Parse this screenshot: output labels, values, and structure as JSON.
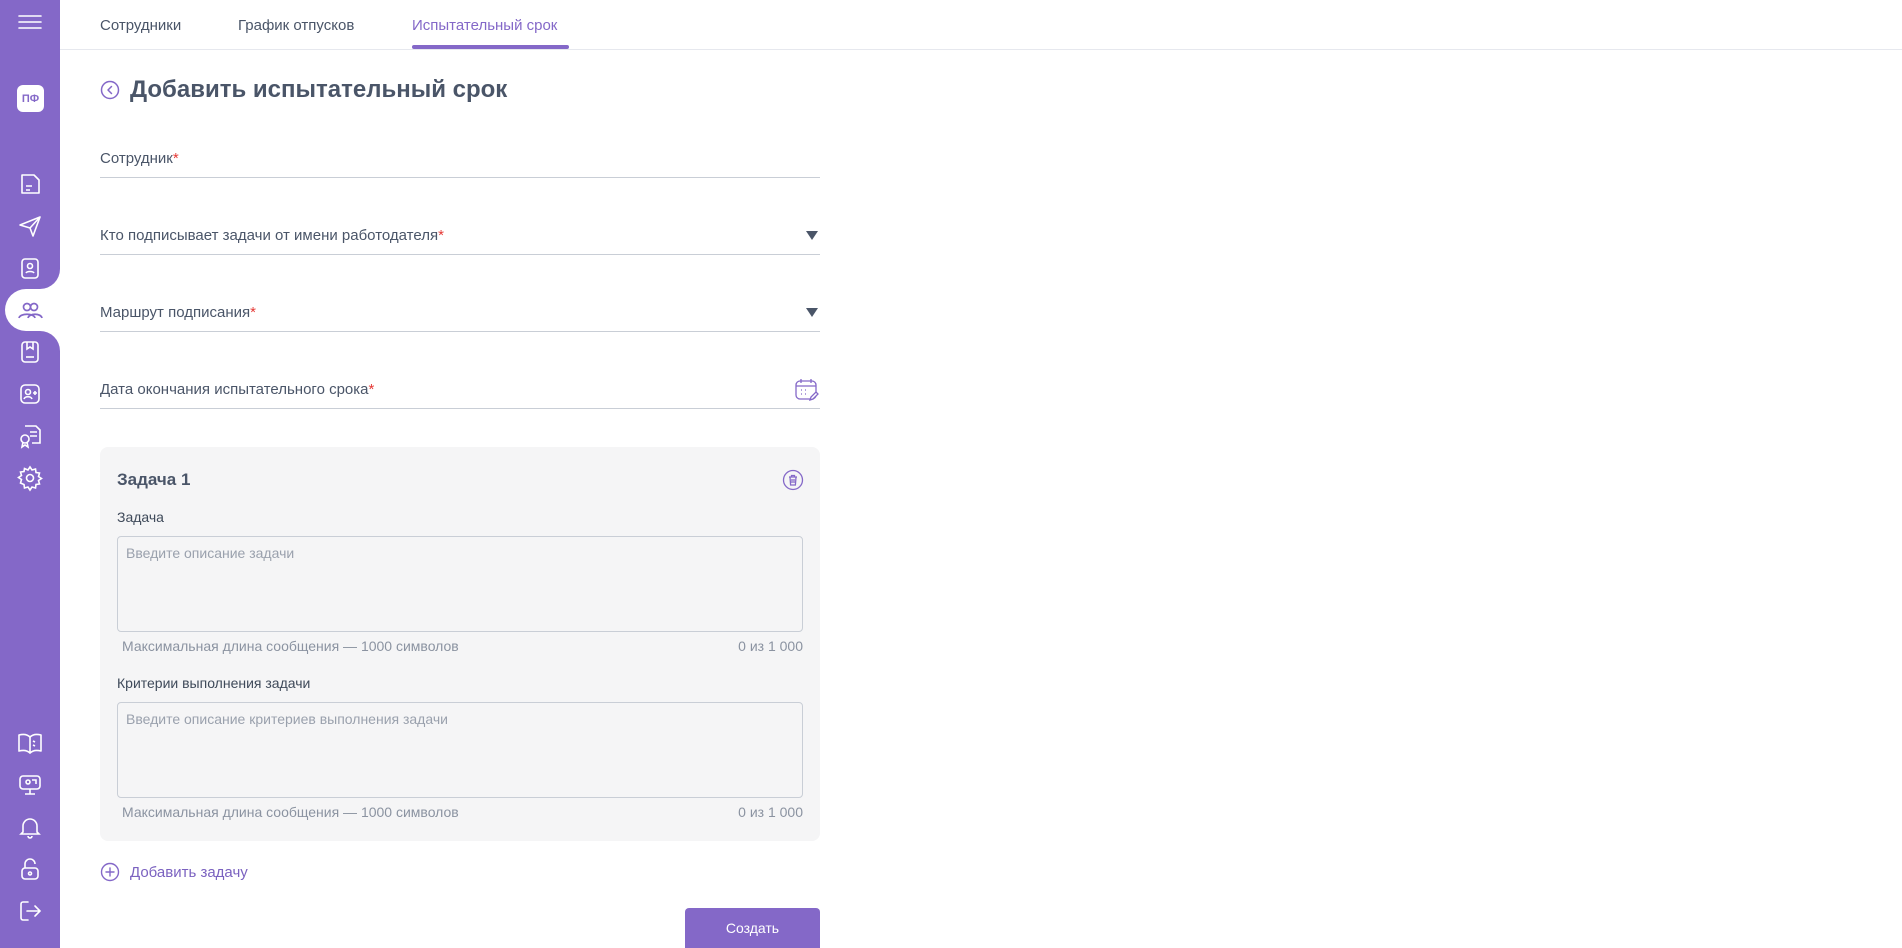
{
  "sidebar": {
    "menu_icon": "hamburger-icon",
    "avatar_initials": "ПФ",
    "items": [
      {
        "icon": "document-icon"
      },
      {
        "icon": "send-icon"
      },
      {
        "icon": "id-badge-icon"
      },
      {
        "icon": "users-icon",
        "active": true
      },
      {
        "icon": "bookmark-doc-icon"
      },
      {
        "icon": "add-user-icon"
      },
      {
        "icon": "certificate-icon"
      },
      {
        "icon": "gear-icon"
      },
      {
        "icon": "book-icon"
      },
      {
        "icon": "chat-screen-icon"
      },
      {
        "icon": "bell-icon"
      },
      {
        "icon": "lock-open-icon"
      },
      {
        "icon": "logout-icon"
      }
    ]
  },
  "tabs": [
    {
      "label": "Сотрудники"
    },
    {
      "label": "График отпусков"
    },
    {
      "label": "Испытательный срок",
      "active": true
    }
  ],
  "page": {
    "title": "Добавить испытательный срок"
  },
  "form": {
    "employee_label": "Сотрудник",
    "signer_label": "Кто подписывает задачи от имени работодателя",
    "route_label": "Маршрут подписания",
    "end_date_label": "Дата окончания испытательного срока",
    "required_mark": "*"
  },
  "task": {
    "title": "Задача 1",
    "task_label": "Задача",
    "task_placeholder": "Введите описание задачи",
    "task_hint": "Максимальная длина сообщения — 1000 символов",
    "task_counter": "0 из 1 000",
    "criteria_label": "Критерии выполнения задачи",
    "criteria_placeholder": "Введите описание критериев выполнения задачи",
    "criteria_hint": "Максимальная длина сообщения — 1000 символов",
    "criteria_counter": "0 из 1 000"
  },
  "actions": {
    "add_task": "Добавить задачу",
    "create": "Создать"
  },
  "colors": {
    "accent": "#8468c8",
    "required": "#e53935"
  }
}
